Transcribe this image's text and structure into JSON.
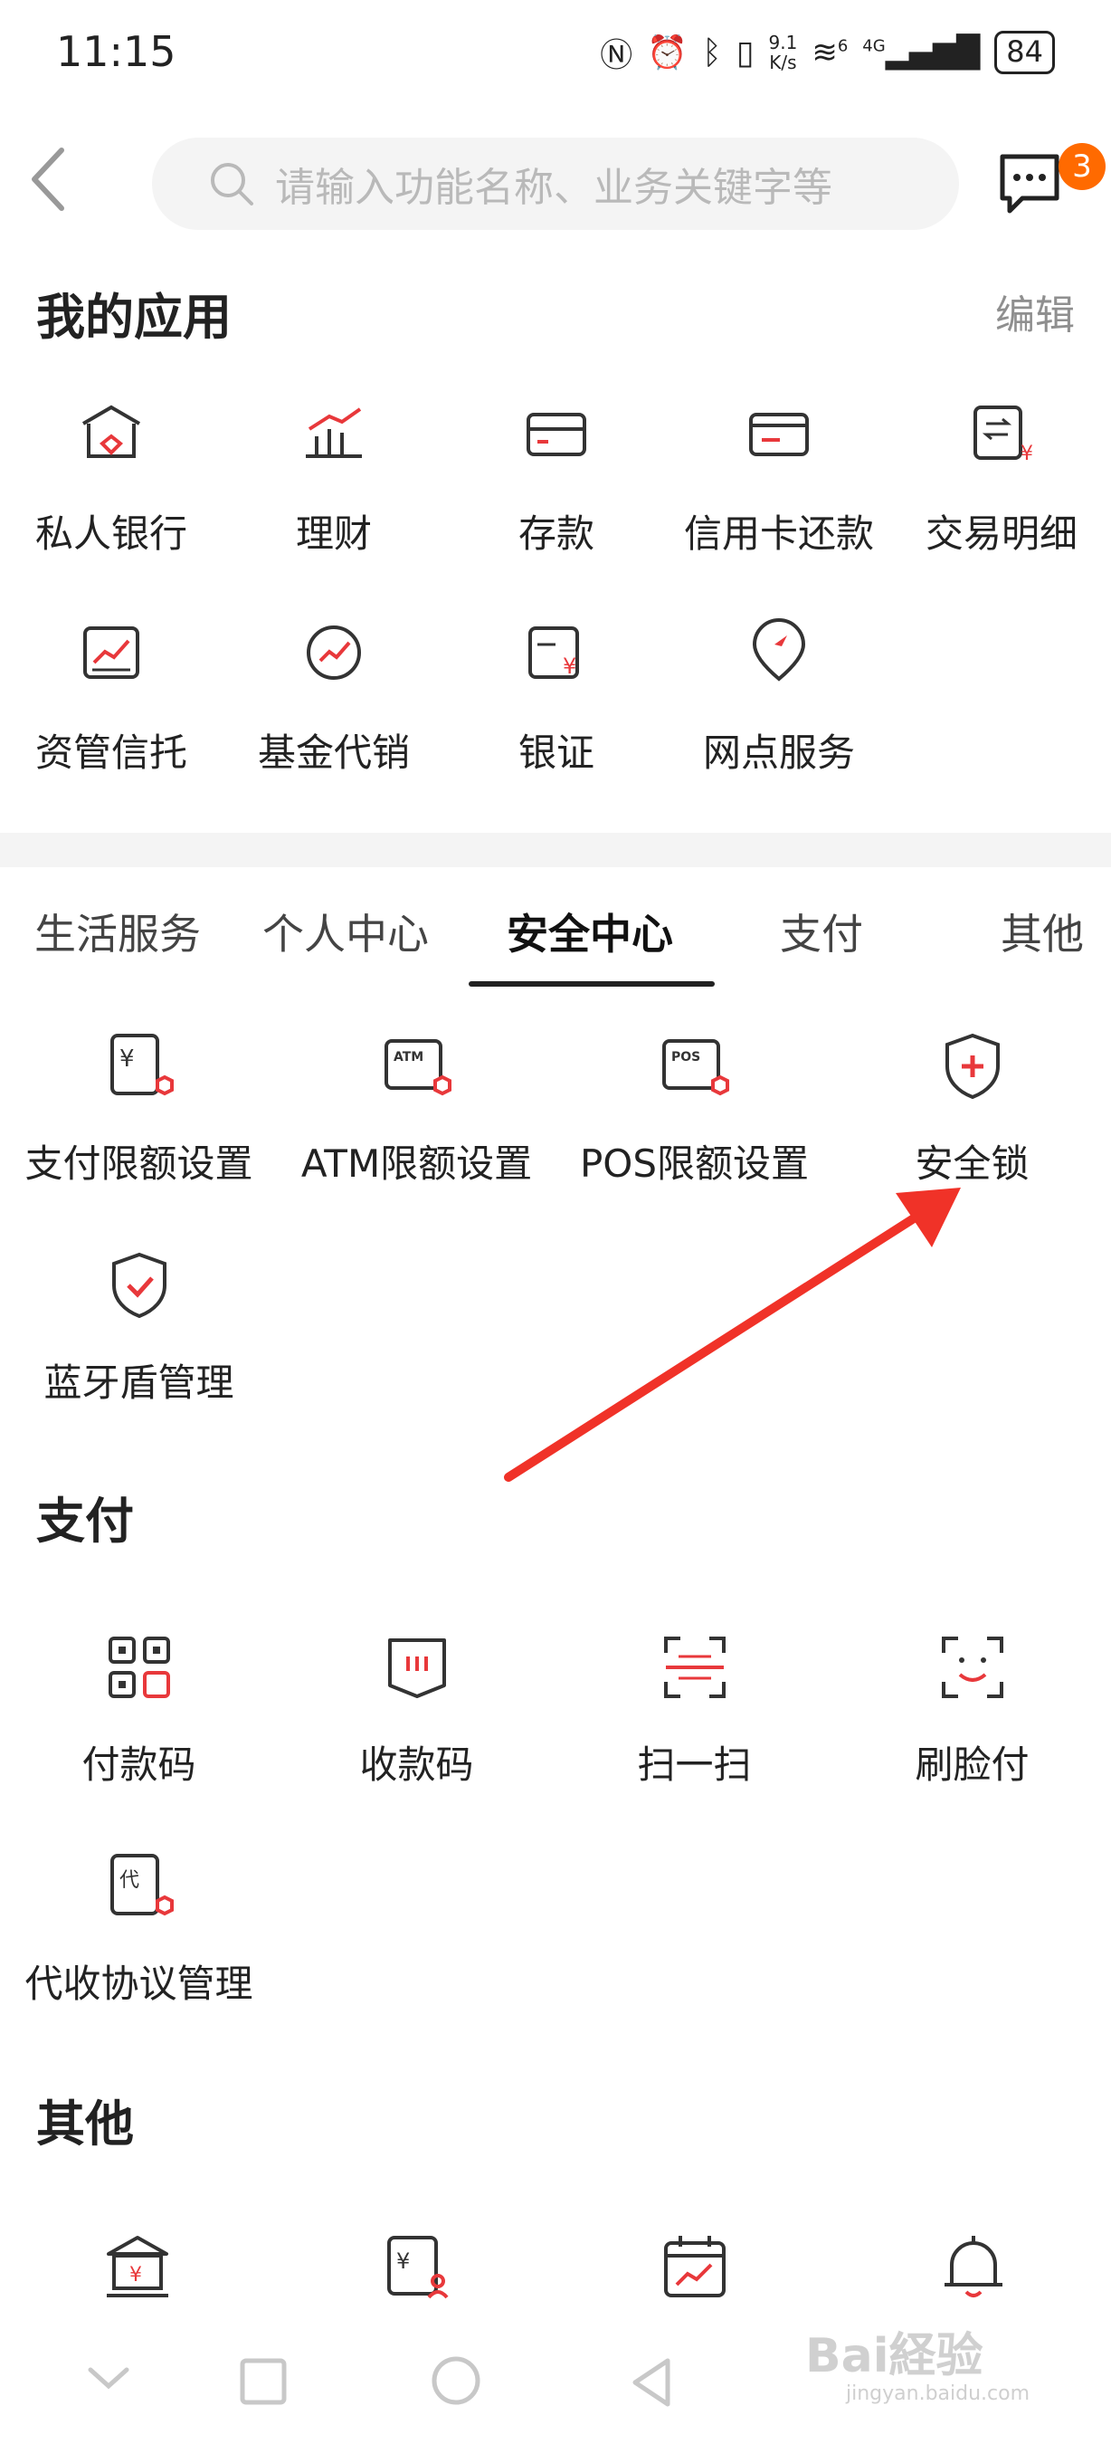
{
  "status_bar": {
    "time": "11:15",
    "net_speed_value": "9.1",
    "net_speed_unit": "K/s",
    "signal_label": "4G",
    "wifi_sup": "6",
    "battery": "84"
  },
  "header": {
    "search_placeholder": "请输入功能名称、业务关键字等",
    "message_count": "3"
  },
  "my_apps": {
    "title": "我的应用",
    "edit_label": "编辑",
    "items": [
      {
        "label": "私人银行",
        "icon": "private-bank-icon"
      },
      {
        "label": "理财",
        "icon": "wealth-chart-icon"
      },
      {
        "label": "存款",
        "icon": "deposit-card-icon"
      },
      {
        "label": "信用卡还款",
        "icon": "credit-card-icon"
      },
      {
        "label": "交易明细",
        "icon": "transaction-detail-icon"
      },
      {
        "label": "资管信托",
        "icon": "asset-trust-icon"
      },
      {
        "label": "基金代销",
        "icon": "fund-icon"
      },
      {
        "label": "银证",
        "icon": "bank-securities-icon"
      },
      {
        "label": "网点服务",
        "icon": "branch-location-icon"
      }
    ]
  },
  "tabs": [
    "生活服务",
    "个人中心",
    "安全中心",
    "支付",
    "其他"
  ],
  "active_tab": "安全中心",
  "security": {
    "items": [
      {
        "label": "支付限额设置",
        "icon": "payment-limit-icon",
        "glyph": "¥"
      },
      {
        "label": "ATM限额设置",
        "icon": "atm-limit-icon",
        "glyph": "ATM"
      },
      {
        "label": "POS限额设置",
        "icon": "pos-limit-icon",
        "glyph": "POS"
      },
      {
        "label": "安全锁",
        "icon": "security-lock-icon"
      },
      {
        "label": "蓝牙盾管理",
        "icon": "bluetooth-shield-icon"
      }
    ]
  },
  "payment": {
    "title": "支付",
    "items": [
      {
        "label": "付款码",
        "icon": "qr-code-icon"
      },
      {
        "label": "收款码",
        "icon": "receive-code-icon"
      },
      {
        "label": "扫一扫",
        "icon": "scan-icon"
      },
      {
        "label": "刷脸付",
        "icon": "face-pay-icon"
      },
      {
        "label": "代收协议管理",
        "icon": "agreement-icon",
        "glyph": "代"
      }
    ]
  },
  "other": {
    "title": "其他",
    "icons": [
      "bank-building-icon",
      "yuan-person-icon",
      "calendar-chart-icon",
      "bell-icon"
    ]
  },
  "watermark": {
    "main": "Bai経验",
    "sub": "jingyan.baidu.com"
  },
  "colors": {
    "accent": "#e8383b",
    "text": "#222222",
    "arrow": "#f03228"
  }
}
